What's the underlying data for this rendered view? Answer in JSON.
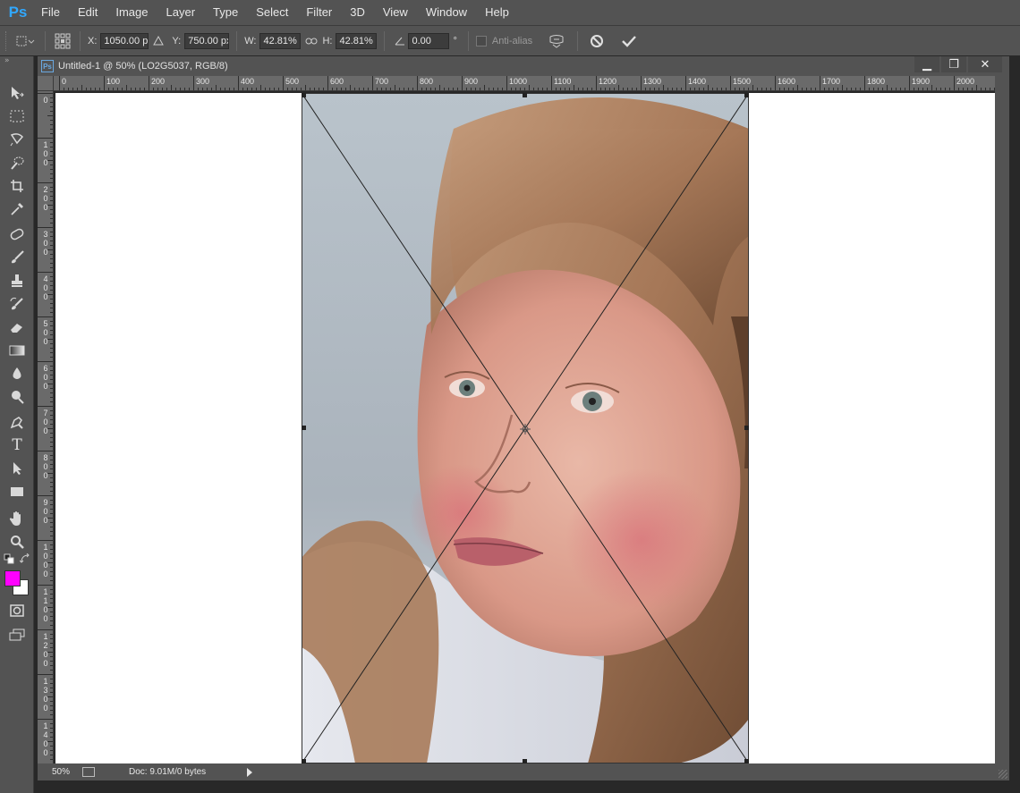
{
  "app": {
    "logo": "Ps"
  },
  "menu": [
    "File",
    "Edit",
    "Image",
    "Layer",
    "Type",
    "Select",
    "Filter",
    "3D",
    "View",
    "Window",
    "Help"
  ],
  "options": {
    "x_label": "X:",
    "x_value": "1050.00 p:",
    "y_label": "Y:",
    "y_value": "750.00 px",
    "w_label": "W:",
    "w_value": "42.81%",
    "h_label": "H:",
    "h_value": "42.81%",
    "angle_value": "0.00",
    "angle_unit": "°",
    "antialias_label": "Anti-alias"
  },
  "document": {
    "ps_badge": "Ps",
    "title": "Untitled-1 @ 50% (LO2G5037, RGB/8)",
    "window_buttons": [
      "▁",
      "❐",
      "✕"
    ]
  },
  "ruler": {
    "h_labels": [
      "0",
      "100",
      "200",
      "300",
      "400",
      "500",
      "600",
      "700",
      "800",
      "900",
      "1000",
      "1100",
      "1200",
      "1300",
      "1400",
      "1500",
      "1600",
      "1700",
      "1800",
      "1900",
      "2000"
    ],
    "v_labels": [
      "0",
      "100",
      "200",
      "300",
      "400",
      "500",
      "600",
      "700",
      "800",
      "900",
      "1000",
      "1100",
      "1200",
      "1300",
      "1400"
    ]
  },
  "status": {
    "zoom": "50%",
    "doc_info": "Doc: 9.01M/0 bytes"
  },
  "colors": {
    "foreground": "#ff00ff",
    "background": "#ffffff"
  },
  "tools": [
    "move-tool-icon",
    "marquee-tool-icon",
    "lasso-tool-icon",
    "quick-select-tool-icon",
    "crop-tool-icon",
    "eyedropper-tool-icon",
    "healing-brush-icon",
    "brush-tool-icon",
    "clone-stamp-icon",
    "history-brush-icon",
    "eraser-tool-icon",
    "gradient-tool-icon",
    "blur-tool-icon",
    "dodge-tool-icon",
    "pen-tool-icon",
    "type-tool-icon",
    "path-select-icon",
    "rectangle-tool-icon",
    "hand-tool-icon",
    "zoom-tool-icon"
  ]
}
